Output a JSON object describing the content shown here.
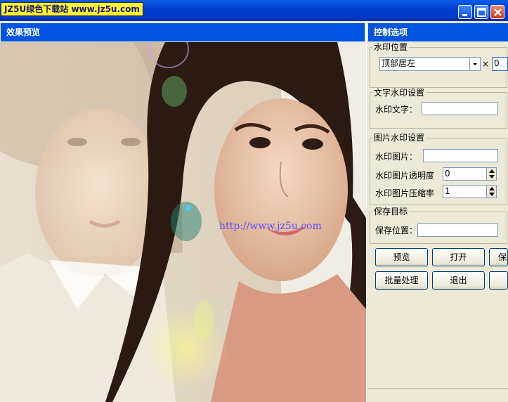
{
  "window": {
    "badge_text": "JZ5U绿色下载站 www.jz5u.com"
  },
  "preview": {
    "header": "效果预览",
    "watermark_text": "http://www.jz5u.com"
  },
  "panel": {
    "header": "控制选项",
    "position_group": {
      "legend": "水印位置",
      "select_value": "顶部居左",
      "times_symbol": "×",
      "offset_value": "0"
    },
    "text_group": {
      "legend": "文字水印设置",
      "text_label": "水印文字：",
      "text_value": ""
    },
    "image_group": {
      "legend": "图片水印设置",
      "image_label": "水印图片：",
      "image_value": "",
      "opacity_label": "水印图片透明度",
      "opacity_value": "0",
      "compress_label": "水印图片压缩率",
      "compress_value": "1"
    },
    "save_group": {
      "legend": "保存目标",
      "location_label": "保存位置：",
      "location_value": ""
    },
    "buttons": {
      "preview": "预览",
      "open": "打开",
      "save": "保",
      "batch": "批量处理",
      "exit": "退出",
      "extra": ""
    }
  },
  "colors": {
    "titlebar_blue": "#0054e3",
    "badge_yellow": "#fff23a",
    "window_bg": "#ece9d8"
  }
}
